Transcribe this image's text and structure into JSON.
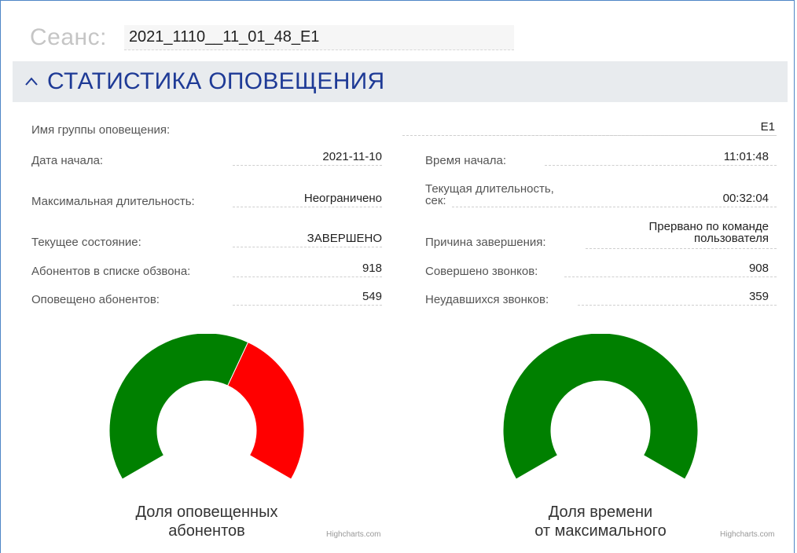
{
  "session": {
    "label": "Сеанс:",
    "value": "2021_1110__11_01_48_E1"
  },
  "section": {
    "title": "СТАТИСТИКА ОПОВЕЩЕНИЯ",
    "chevron_icon": "chevron-up-icon"
  },
  "stats": {
    "group_name": {
      "label": "Имя группы оповещения:",
      "value": "E1"
    },
    "start_date": {
      "label": "Дата начала:",
      "value": "2021-11-10"
    },
    "start_time": {
      "label": "Время начала:",
      "value": "11:01:48"
    },
    "max_duration": {
      "label": "Максимальная длительность:",
      "value": "Неограничено"
    },
    "current_duration": {
      "label_line1": "Текущая длительность,",
      "label_line2": "сек:",
      "value": "00:32:04"
    },
    "current_state": {
      "label": "Текущее состояние:",
      "value": "ЗАВЕРШЕНО"
    },
    "end_reason": {
      "label": "Причина завершения:",
      "value_line1": "Прервано по команде",
      "value_line2": "пользователя"
    },
    "subscribers_in_list": {
      "label": "Абонентов в списке обзвона:",
      "value": "918"
    },
    "calls_made": {
      "label": "Совершено звонков:",
      "value": "908"
    },
    "notified": {
      "label": "Оповещено абонентов:",
      "value": "549"
    },
    "failed_calls": {
      "label": "Неудавшихся звонков:",
      "value": "359"
    }
  },
  "chart_data": [
    {
      "type": "pie",
      "subtype": "semi-donut-gauge",
      "title_line1": "Доля оповещенных",
      "title_line2": "абонентов",
      "slices": [
        {
          "value": 549,
          "color": "#008000"
        },
        {
          "value": 359,
          "color": "#ff0000"
        }
      ],
      "credits": "Highcharts.com"
    },
    {
      "type": "pie",
      "subtype": "semi-donut-gauge",
      "title_line1": "Доля времени",
      "title_line2": "от максимального",
      "slices": [
        {
          "value": 1,
          "color": "#008000"
        }
      ],
      "credits": "Highcharts.com"
    }
  ],
  "colors": {
    "header_bg": "#e8ebee",
    "header_text": "#1e3a96",
    "border": "#4f86c6"
  }
}
